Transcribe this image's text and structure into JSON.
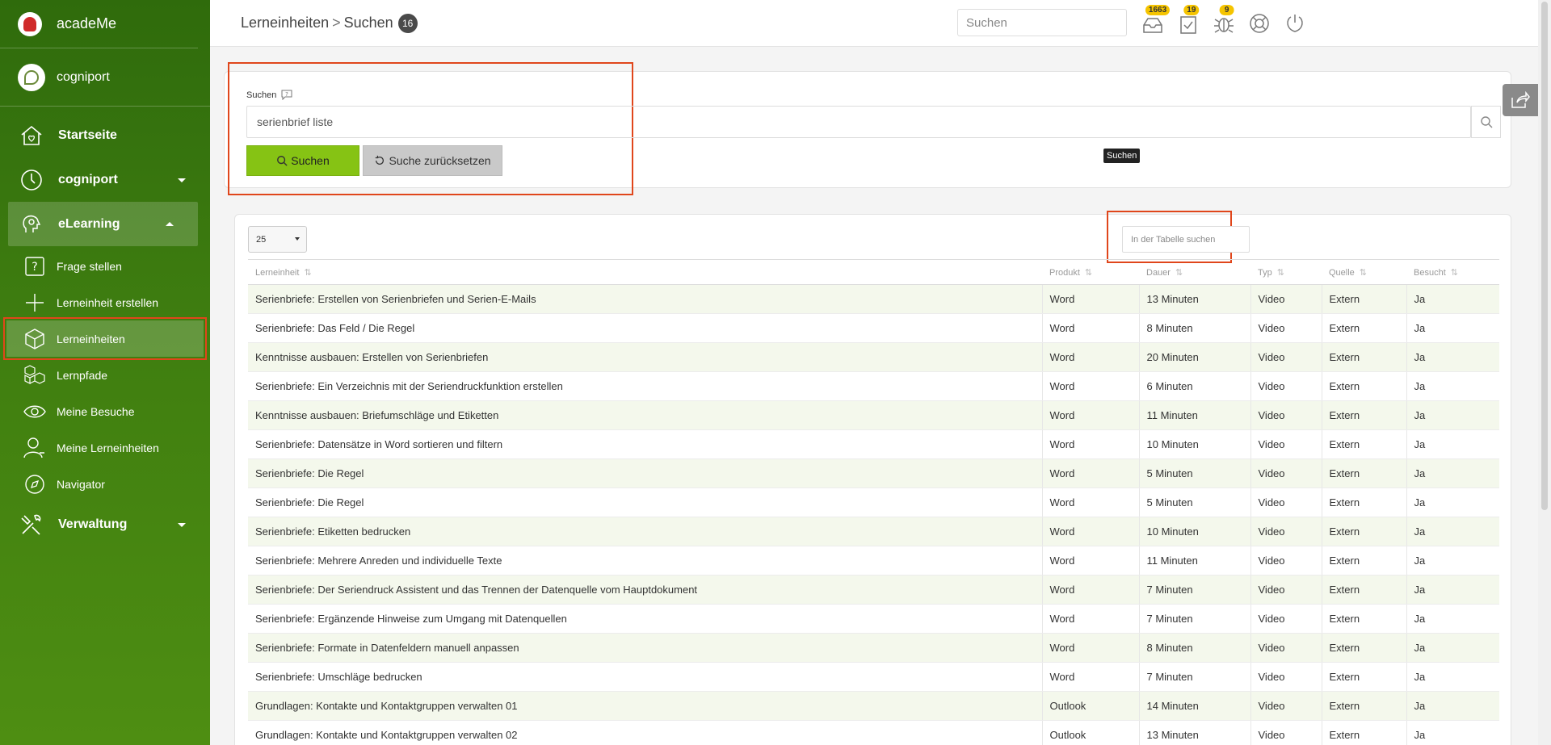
{
  "app": {
    "name": "acadeMe",
    "org": "cogniport"
  },
  "nav": {
    "home": "Startseite",
    "cogniport": "cogniport",
    "elearning": "eLearning",
    "sub": {
      "ask": "Frage stellen",
      "create": "Lerneinheit erstellen",
      "units": "Lerneinheiten",
      "paths": "Lernpfade",
      "visits": "Meine Besuche",
      "myunits": "Meine Lerneinheiten",
      "navigator": "Navigator"
    },
    "admin": "Verwaltung"
  },
  "header": {
    "crumb1": "Lerneinheiten",
    "sep": ">",
    "crumb2": "Suchen",
    "count": "16",
    "search_placeholder": "Suchen",
    "badges": {
      "inbox": "1663",
      "tasks": "19",
      "bugs": "9"
    }
  },
  "search": {
    "label": "Suchen",
    "value": "serienbrief liste",
    "search_button": "Suchen",
    "reset_button": "Suche zurücksetzen",
    "tooltip": "Suchen"
  },
  "table": {
    "page_size": "25",
    "filter_placeholder": "In der Tabelle suchen",
    "columns": [
      "Lerneinheit",
      "Produkt",
      "Dauer",
      "Typ",
      "Quelle",
      "Besucht"
    ],
    "rows": [
      [
        "Serienbriefe: Erstellen von Serienbriefen und Serien-E-Mails",
        "Word",
        "13 Minuten",
        "Video",
        "Extern",
        "Ja"
      ],
      [
        "Serienbriefe: Das Feld / Die Regel",
        "Word",
        "8 Minuten",
        "Video",
        "Extern",
        "Ja"
      ],
      [
        "Kenntnisse ausbauen: Erstellen von Serienbriefen",
        "Word",
        "20 Minuten",
        "Video",
        "Extern",
        "Ja"
      ],
      [
        "Serienbriefe: Ein Verzeichnis mit der Seriendruckfunktion erstellen",
        "Word",
        "6 Minuten",
        "Video",
        "Extern",
        "Ja"
      ],
      [
        "Kenntnisse ausbauen: Briefumschläge und Etiketten",
        "Word",
        "11 Minuten",
        "Video",
        "Extern",
        "Ja"
      ],
      [
        "Serienbriefe: Datensätze in Word sortieren und filtern",
        "Word",
        "10 Minuten",
        "Video",
        "Extern",
        "Ja"
      ],
      [
        "Serienbriefe: Die Regel",
        "Word",
        "5 Minuten",
        "Video",
        "Extern",
        "Ja"
      ],
      [
        "Serienbriefe: Die Regel",
        "Word",
        "5 Minuten",
        "Video",
        "Extern",
        "Ja"
      ],
      [
        "Serienbriefe: Etiketten bedrucken",
        "Word",
        "10 Minuten",
        "Video",
        "Extern",
        "Ja"
      ],
      [
        "Serienbriefe: Mehrere Anreden und individuelle Texte",
        "Word",
        "11 Minuten",
        "Video",
        "Extern",
        "Ja"
      ],
      [
        "Serienbriefe: Der Seriendruck Assistent und das Trennen der Datenquelle vom Hauptdokument",
        "Word",
        "7 Minuten",
        "Video",
        "Extern",
        "Ja"
      ],
      [
        "Serienbriefe: Ergänzende Hinweise zum Umgang mit Datenquellen",
        "Word",
        "7 Minuten",
        "Video",
        "Extern",
        "Ja"
      ],
      [
        "Serienbriefe: Formate in Datenfeldern manuell anpassen",
        "Word",
        "8 Minuten",
        "Video",
        "Extern",
        "Ja"
      ],
      [
        "Serienbriefe: Umschläge bedrucken",
        "Word",
        "7 Minuten",
        "Video",
        "Extern",
        "Ja"
      ],
      [
        "Grundlagen: Kontakte und Kontaktgruppen verwalten 01",
        "Outlook",
        "14 Minuten",
        "Video",
        "Extern",
        "Ja"
      ],
      [
        "Grundlagen: Kontakte und Kontaktgruppen verwalten 02",
        "Outlook",
        "13 Minuten",
        "Video",
        "Extern",
        "Ja"
      ]
    ]
  },
  "colors": {
    "sidebar": "#3f7e10",
    "accent": "#86c314",
    "highlight": "#e0461b"
  }
}
